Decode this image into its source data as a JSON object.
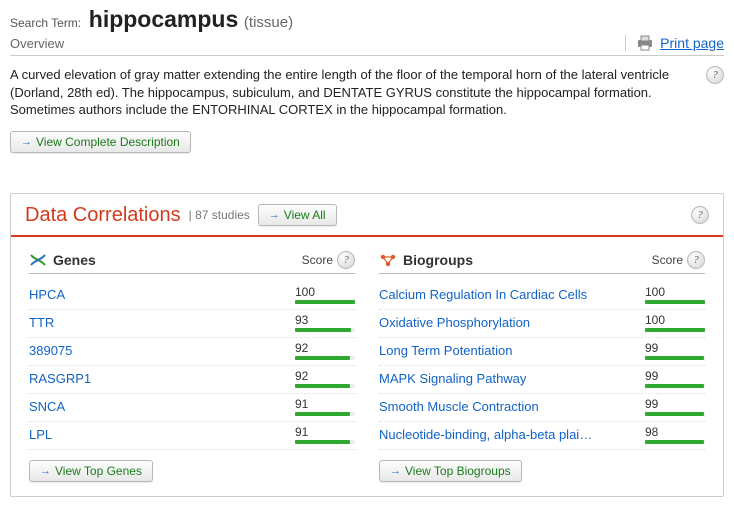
{
  "search": {
    "label": "Search Term:",
    "term": "hippocampus",
    "type": "(tissue)"
  },
  "overview_label": "Overview",
  "print_label": "Print page",
  "description": "A curved elevation of gray matter extending the entire length of the floor of the temporal horn of the lateral ventricle (Dorland, 28th ed). The hippocampus, subiculum, and DENTATE GYRUS constitute the hippocampal formation. Sometimes authors include the ENTORHINAL CORTEX in the hippocampal formation.",
  "view_complete_label": "View Complete Description",
  "panel": {
    "title": "Data Correlations",
    "studies_label": "| 87 studies",
    "view_all_label": "View All"
  },
  "genes": {
    "title": "Genes",
    "score_label": "Score",
    "button_label": "View Top Genes",
    "items": [
      {
        "name": "HPCA",
        "score": 100
      },
      {
        "name": "TTR",
        "score": 93
      },
      {
        "name": "389075",
        "score": 92
      },
      {
        "name": "RASGRP1",
        "score": 92
      },
      {
        "name": "SNCA",
        "score": 91
      },
      {
        "name": "LPL",
        "score": 91
      }
    ]
  },
  "biogroups": {
    "title": "Biogroups",
    "score_label": "Score",
    "button_label": "View Top Biogroups",
    "items": [
      {
        "name": "Calcium Regulation In Cardiac Cells",
        "score": 100
      },
      {
        "name": "Oxidative Phosphorylation",
        "score": 100
      },
      {
        "name": "Long Term Potentiation",
        "score": 99
      },
      {
        "name": "MAPK Signaling Pathway",
        "score": 99
      },
      {
        "name": "Smooth Muscle Contraction",
        "score": 99
      },
      {
        "name": "Nucleotide-binding, alpha-beta plai…",
        "score": 98
      }
    ]
  },
  "chart_data": {
    "type": "table",
    "title": "Data Correlations — top Genes and Biogroups scores",
    "series": [
      {
        "name": "Genes",
        "categories": [
          "HPCA",
          "TTR",
          "389075",
          "RASGRP1",
          "SNCA",
          "LPL"
        ],
        "values": [
          100,
          93,
          92,
          92,
          91,
          91
        ]
      },
      {
        "name": "Biogroups",
        "categories": [
          "Calcium Regulation In Cardiac Cells",
          "Oxidative Phosphorylation",
          "Long Term Potentiation",
          "MAPK Signaling Pathway",
          "Smooth Muscle Contraction",
          "Nucleotide-binding, alpha-beta plai…"
        ],
        "values": [
          100,
          100,
          99,
          99,
          99,
          98
        ]
      }
    ],
    "ylim": [
      0,
      100
    ]
  }
}
